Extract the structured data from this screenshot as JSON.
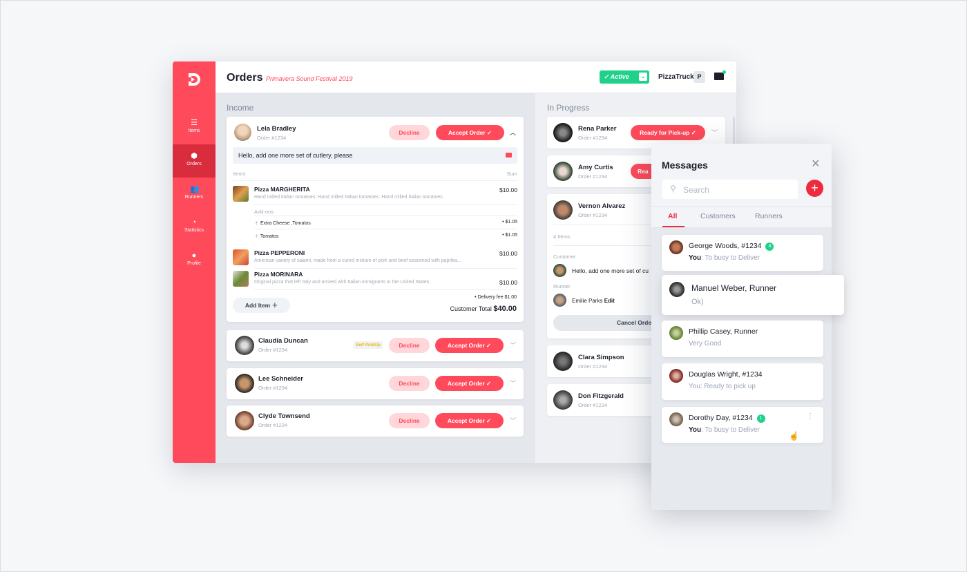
{
  "header": {
    "title": "Orders",
    "subtitle": "Primavera Sound Festival 2019",
    "status": "Active",
    "brand": "PizzaTruck",
    "brand_initial": "P"
  },
  "sidebar": {
    "items": [
      {
        "label": "Items",
        "icon": "list-icon"
      },
      {
        "label": "Orders",
        "icon": "box-icon",
        "active": true
      },
      {
        "label": "Runners",
        "icon": "users-icon"
      },
      {
        "label": "Statistics",
        "icon": "pie-chart-icon"
      },
      {
        "label": "Profile",
        "icon": "user-icon"
      }
    ]
  },
  "income": {
    "title": "Income",
    "expanded": {
      "name": "Lela Bradley",
      "order": "Order #1234",
      "message": "Hello, add one more set of cutlery, please",
      "items_header": "Items",
      "sum_header": "Sum",
      "items": [
        {
          "name": "Pizza MARGHERITA",
          "desc": "Hand milled Italian tomatoes. Hand milled Italian tomatoes. Hand milled Italian tomatoes.",
          "price": "$10.00"
        },
        {
          "name": "Pizza PEPPERONI",
          "desc": "American variety of salami, made from a cured mixture of pork and beef seasoned with paprika...",
          "price": "$10.00"
        },
        {
          "name": "Pizza MORINARA",
          "desc": "Original pizza that left Italy and arrived with Italian immigrants in the United States.",
          "price": "$10.00"
        }
      ],
      "addons_label": "Add-ons",
      "addons": [
        {
          "name": "Extra Cheese ,Tomatos",
          "price": "• $1.05"
        },
        {
          "name": "Tomatos",
          "price": "• $1.05"
        }
      ],
      "add_item": "Add Item",
      "delivery_fee": "• Delivery fee $1.00",
      "total_label": "Customer Total",
      "total": "$40.00"
    },
    "orders": [
      {
        "name": "Claudia Duncan",
        "order": "Order #1234",
        "badge": "Self PickUp"
      },
      {
        "name": "Lee Schneider",
        "order": "Order #1234"
      },
      {
        "name": "Clyde Townsend",
        "order": "Order #1234"
      }
    ],
    "decline": "Decline",
    "accept": "Accept Order"
  },
  "progress": {
    "title": "In Progress",
    "ready": "Ready for Pick-up",
    "ready_partial": "Rea",
    "orders": [
      {
        "name": "Rena Parker",
        "order": "Order #1234"
      },
      {
        "name": "Amy Curtis",
        "order": "Order #1234"
      },
      {
        "name": "Vernon Alvarez",
        "order": "Order #1234"
      },
      {
        "name": "Clara Simpson",
        "order": "Order #1234"
      },
      {
        "name": "Don Fitzgerald",
        "order": "Order #1234"
      }
    ],
    "detail": {
      "items_count": "4 Items",
      "customer_label": "Customer",
      "customer_message": "Hello, add one more set of cu",
      "runner_label": "Runner",
      "runner": "Emilie Parks",
      "edit": "Edit",
      "cancel": "Cancel Orde"
    }
  },
  "messages": {
    "title": "Messages",
    "search_placeholder": "Search",
    "tabs": [
      "All",
      "Customers",
      "Runners"
    ],
    "active_tab": "All",
    "threads": [
      {
        "name": "George Woods, #1234",
        "prefix": "You",
        "text": ": To busy to Deliver",
        "count": "4"
      },
      {
        "name": "Manuel Weber, Runner",
        "text": "Ok)"
      },
      {
        "name": "Phillip Casey, Runner",
        "text": "Very Good"
      },
      {
        "name": "Douglas Wright, #1234",
        "text": "You: Ready to pick up"
      },
      {
        "name": "Dorothy Day, #1234",
        "prefix": "You",
        "text": ": To busy to Deliver",
        "count": "1"
      }
    ]
  },
  "colors": {
    "accent": "#fe4a5a",
    "success": "#1fd18a",
    "badge": "#f5b50a"
  }
}
